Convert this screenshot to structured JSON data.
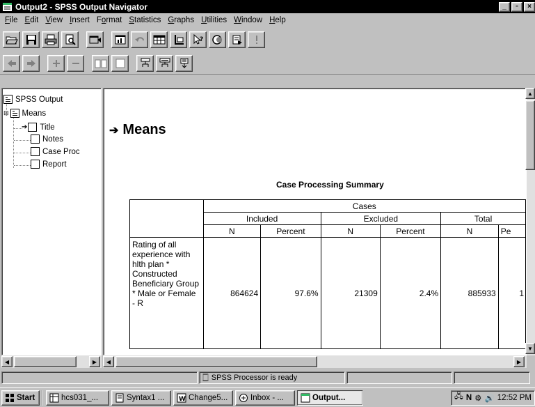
{
  "window": {
    "title": "Output2 - SPSS Output Navigator"
  },
  "menu": {
    "items": [
      "File",
      "Edit",
      "View",
      "Insert",
      "Format",
      "Statistics",
      "Graphs",
      "Utilities",
      "Window",
      "Help"
    ],
    "mnemonic_index": [
      0,
      0,
      0,
      0,
      1,
      0,
      0,
      0,
      0,
      0
    ]
  },
  "toolbar1": {
    "icons": [
      "open-icon",
      "save-icon",
      "print-icon",
      "print-preview-icon",
      "dialog-recall-icon",
      "goto-chart-icon",
      "undo-icon",
      "goto-data-icon",
      "insert-variable-icon",
      "help-cursor-icon",
      "use-sets-icon",
      "designate-window-icon",
      "run-icon"
    ]
  },
  "toolbar2": {
    "icons": [
      "promote-icon",
      "demote-icon",
      "expand-icon",
      "collapse-icon",
      "show-icon",
      "hide-icon",
      "insert-heading-icon",
      "insert-title-icon",
      "insert-text-icon"
    ]
  },
  "outline": {
    "root": "SPSS Output",
    "means": "Means",
    "title": "Title",
    "notes": "Notes",
    "case_proc": "Case Proc",
    "report": "Report"
  },
  "content": {
    "heading": "Means",
    "table_title": "Case Processing Summary",
    "cases": "Cases",
    "included": "Included",
    "excluded": "Excluded",
    "total": "Total",
    "n": "N",
    "percent": "Percent",
    "percent_cut": "Pe",
    "row_label": "Rating of all experience with hlth plan * Constructed Beneficiary Group * Male or Female - R",
    "inc_n": "864624",
    "inc_pct": "97.6%",
    "exc_n": "21309",
    "exc_pct": "2.4%",
    "tot_n": "885933",
    "tot_pct_cut": "1"
  },
  "status": {
    "message": "SPSS Processor is ready"
  },
  "taskbar": {
    "start": "Start",
    "tasks": [
      "hcs031_...",
      "Syntax1 ...",
      "Change5...",
      "Inbox - ...",
      "Output..."
    ],
    "active_index": 4,
    "clock": "12:52 PM"
  }
}
